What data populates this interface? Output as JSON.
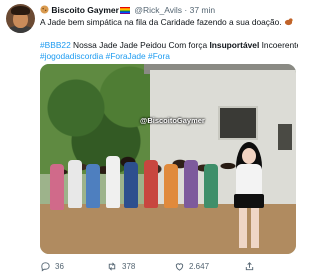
{
  "tweet": {
    "display_name": "Biscoito Gaymer",
    "handle": "@Rick_Avils",
    "separator": "·",
    "time": "37 min",
    "line1": "A Jade bem simpática na fila da Caridade fazendo a sua doação.",
    "line2": {
      "hashtag": "#BBB22",
      "text_a": " Nossa Jade Jade Peidou Com força ",
      "bold": "Insuportável",
      "text_b": " Incoerente"
    },
    "line3": {
      "h1": "#jogodadiscordia",
      "h2": "#ForaJade",
      "h3": "#Fora"
    },
    "image_overlay_text": "@BiscoitoGaymer"
  },
  "actions": {
    "replies": "36",
    "retweets": "378",
    "likes": "2.647"
  },
  "colors": {
    "link": "#1d9bf0",
    "muted": "#536471",
    "text": "#0f1419"
  },
  "icons": {
    "verified_like": "rainbow-flag-icon",
    "emoji_1": "biscuit-emoji-icon",
    "emoji_2": "eyes-emoji-icon",
    "more": "more-icon",
    "reply": "reply-icon",
    "retweet": "retweet-icon",
    "like": "heart-icon",
    "share": "share-icon"
  }
}
